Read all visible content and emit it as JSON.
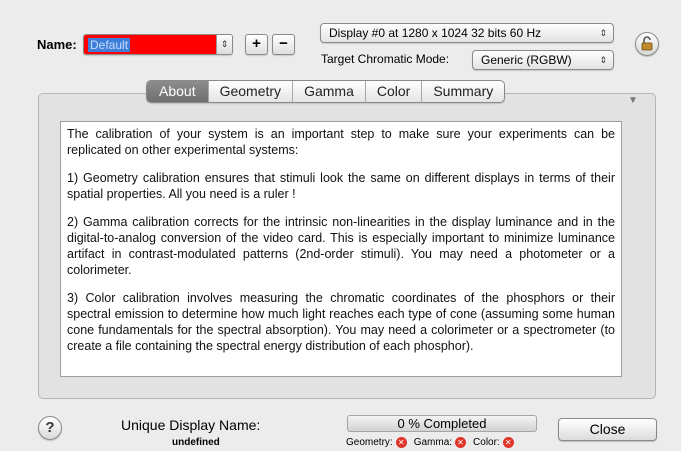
{
  "name": {
    "label": "Name:",
    "value": "Default",
    "field_color": "#ff0000"
  },
  "buttons": {
    "plus": "+",
    "minus": "−",
    "close": "Close",
    "help": "?"
  },
  "display": {
    "selected": "Display #0 at 1280 x 1024  32 bits  60 Hz"
  },
  "chromatic": {
    "label": "Target Chromatic Mode:",
    "selected": "Generic (RGBW)"
  },
  "tabs": [
    {
      "label": "About",
      "active": true
    },
    {
      "label": "Geometry",
      "active": false
    },
    {
      "label": "Gamma",
      "active": false
    },
    {
      "label": "Color",
      "active": false
    },
    {
      "label": "Summary",
      "active": false
    }
  ],
  "about": {
    "paragraphs": [
      "The calibration of your system is an important step to make sure your experiments can be replicated on other experimental systems:",
      "1) Geometry calibration ensures that stimuli look the same on different displays in terms of their spatial properties. All you need is a ruler !",
      "2) Gamma calibration corrects for the intrinsic non-linearities in the display luminance and in the digital-to-analog conversion of the video card. This is especially important to minimize luminance artifact in contrast-modulated patterns (2nd-order stimuli). You may need a photometer or a colorimeter.",
      "3) Color calibration involves measuring the chromatic coordinates of the phosphors or their spectral emission to determine how much light reaches each type of cone (assuming some human cone fundamentals for the spectral absorption). You may need a colorimeter or a spectrometer (to create a file containing the spectral energy distribution of each phosphor)."
    ]
  },
  "unique_display": {
    "label": "Unique Display Name:",
    "value": "undefined"
  },
  "progress": {
    "text": "0 % Completed",
    "fraction": 0,
    "geometry_label": "Geometry:",
    "gamma_label": "Gamma:",
    "color_label": "Color:",
    "status_icon": "error-x-icon",
    "status_color": "#e0352b"
  }
}
